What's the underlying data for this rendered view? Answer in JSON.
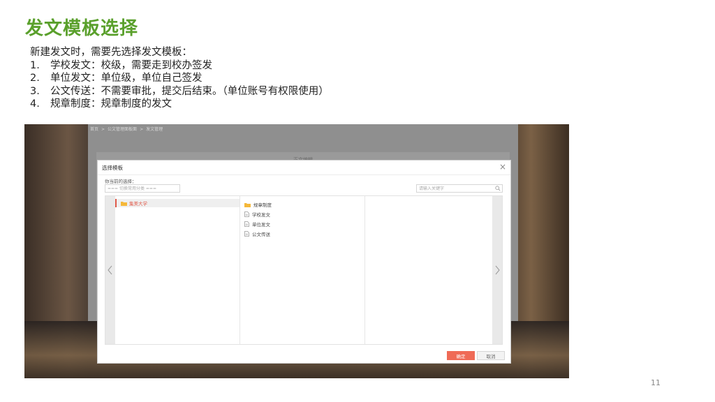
{
  "slide": {
    "title": "发文模板选择",
    "intro": "新建发文时，需要先选择发文模板：",
    "items": [
      {
        "num": "1.",
        "text": "学校发文：校级，需要走到校办签发"
      },
      {
        "num": "2.",
        "text": "单位发文：单位级，单位自己签发"
      },
      {
        "num": "3.",
        "text": "公文传送：不需要审批，提交后结束。（单位账号有权限使用）"
      },
      {
        "num": "4.",
        "text": "规章制度：规章制度的发文"
      }
    ],
    "page_number": "11"
  },
  "screenshot": {
    "breadcrumb": [
      "首页",
      ">",
      "公文管理面板面",
      ">",
      "发文管理"
    ],
    "panel_header": "正文编辑",
    "dialog": {
      "title": "选择模板",
      "close": "×",
      "selection_label": "你当前的选择：",
      "category_placeholder": "=== 切换常用分类 ===",
      "search_placeholder": "请输入关键字",
      "org": "集美大学",
      "templates": [
        {
          "name": "规章制度",
          "icon": "folder-icon"
        },
        {
          "name": "学校发文",
          "icon": "document-icon"
        },
        {
          "name": "单位发文",
          "icon": "document-icon"
        },
        {
          "name": "公文传送",
          "icon": "document-icon"
        }
      ],
      "ok_label": "确定",
      "cancel_label": "取消"
    }
  },
  "colors": {
    "title_green": "#5aa02c",
    "accent_red": "#e05a4a",
    "ok_button": "#ef6a56",
    "folder_yellow": "#f5b83a"
  }
}
